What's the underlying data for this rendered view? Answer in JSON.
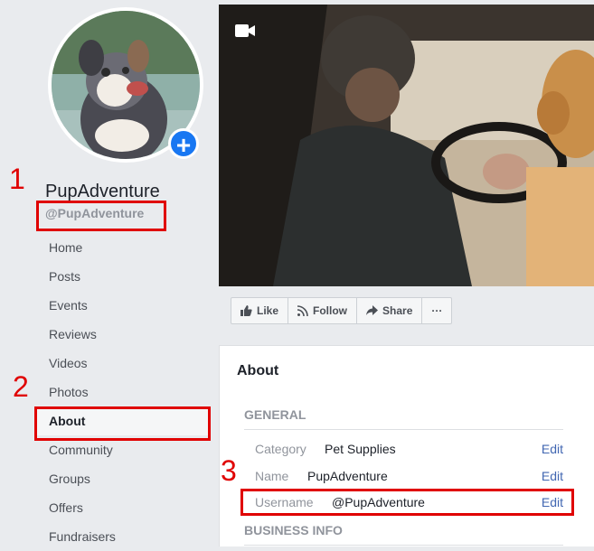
{
  "profile": {
    "page_name": "PupAdventure",
    "handle": "@PupAdventure"
  },
  "nav": {
    "items": [
      "Home",
      "Posts",
      "Events",
      "Reviews",
      "Videos",
      "Photos",
      "About",
      "Community",
      "Groups",
      "Offers",
      "Fundraisers"
    ],
    "active": "About"
  },
  "annotations": [
    "1",
    "2",
    "3"
  ],
  "actions": {
    "like": "Like",
    "follow": "Follow",
    "share": "Share",
    "more": "···"
  },
  "about": {
    "title": "About",
    "general_heading": "GENERAL",
    "rows": [
      {
        "label": "Category",
        "value": "Pet Supplies",
        "edit": "Edit"
      },
      {
        "label": "Name",
        "value": "PupAdventure",
        "edit": "Edit"
      },
      {
        "label": "Username",
        "value": "@PupAdventure",
        "edit": "Edit"
      }
    ],
    "business_heading": "BUSINESS INFO"
  },
  "colors": {
    "accent": "#1877f2",
    "link": "#4267b2",
    "annotation": "#e00000",
    "background": "#e9ebee"
  },
  "icons": [
    "plus-icon",
    "video-camera-icon",
    "thumbs-up-icon",
    "rss-icon",
    "share-arrow-icon",
    "more-icon"
  ]
}
